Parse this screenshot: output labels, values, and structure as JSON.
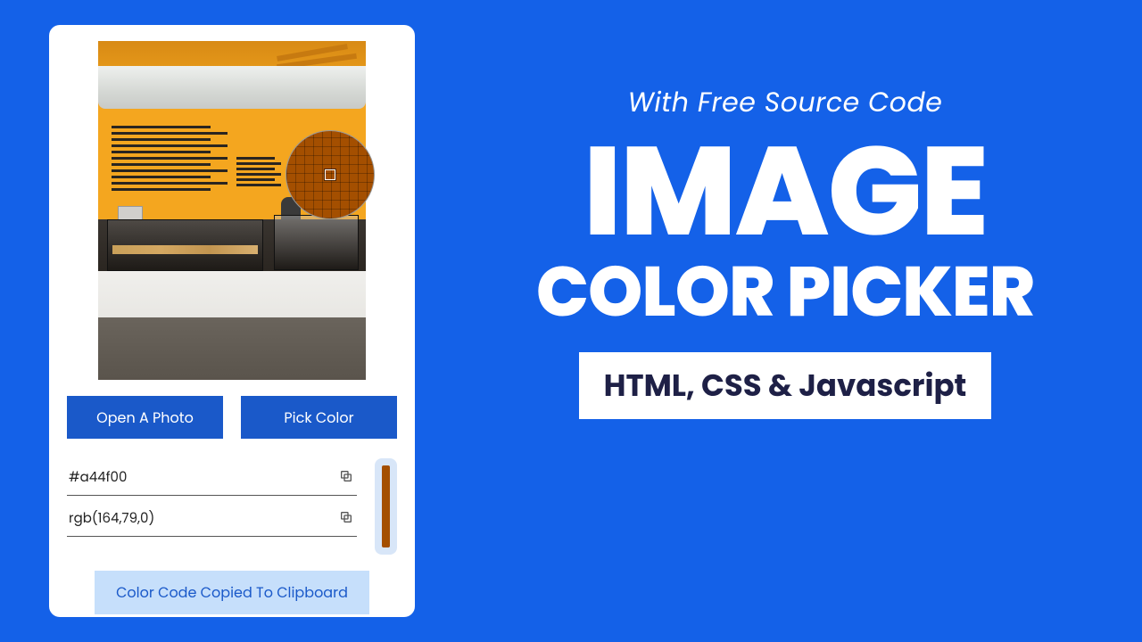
{
  "picker": {
    "open_label": "Open A Photo",
    "pick_label": "Pick Color",
    "hex_value": "#a44f00",
    "rgb_value": "rgb(164,79,0)",
    "swatch_color": "#a44f00",
    "toast_message": "Color Code Copied To Clipboard",
    "magnifier_color": "#a44f00"
  },
  "hero": {
    "subtitle": "With Free Source Code",
    "title_line1": "IMAGE",
    "title_line2": "COLOR PICKER",
    "tag": "HTML, CSS & Javascript"
  },
  "icons": {
    "copy": "copy-icon"
  }
}
